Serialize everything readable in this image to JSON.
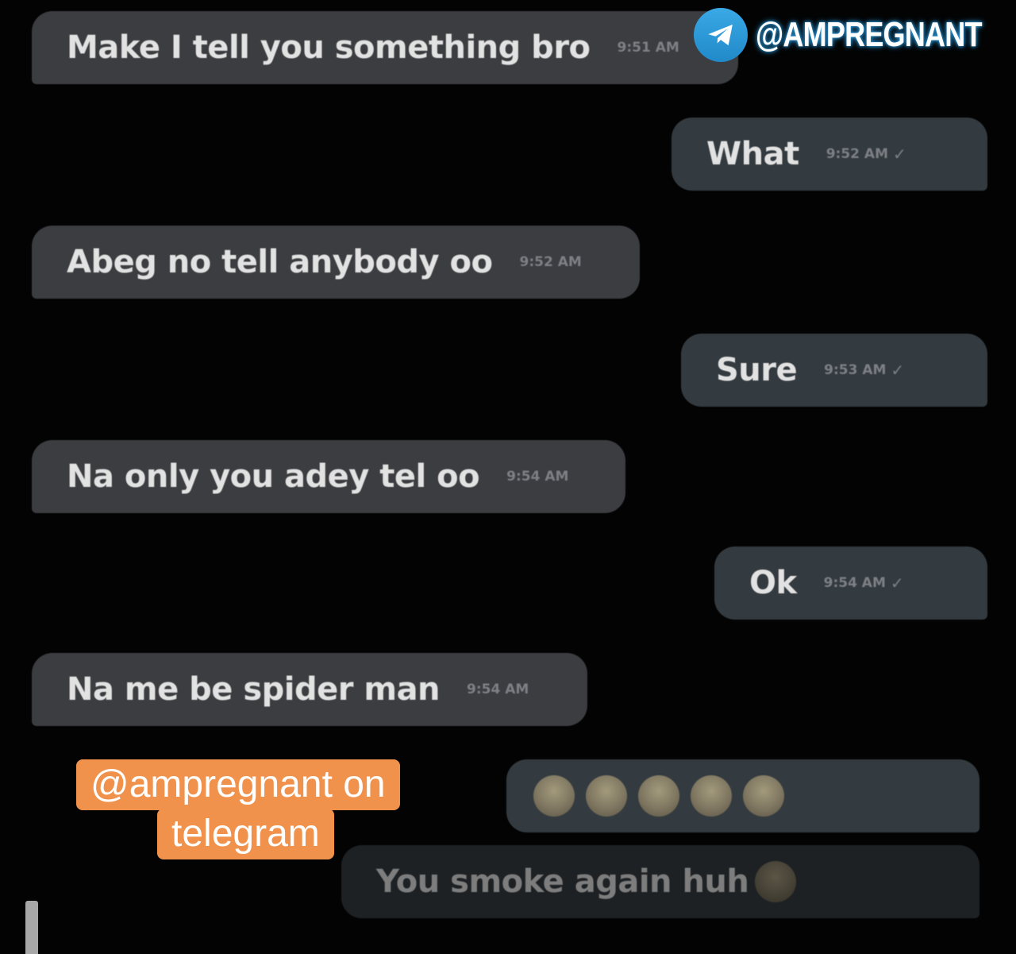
{
  "watermark": {
    "icon": "telegram-logo-icon",
    "handle": "@AMPREGNANT"
  },
  "promo": {
    "line1": "@ampregnant on",
    "line2": "telegram"
  },
  "messages": [
    {
      "direction": "incoming",
      "text": "Make I tell you something bro",
      "time": "9:51 AM"
    },
    {
      "direction": "outgoing",
      "text": "What",
      "time": "9:52 AM"
    },
    {
      "direction": "incoming",
      "text": "Abeg no tell anybody oo",
      "time": "9:52 AM"
    },
    {
      "direction": "outgoing",
      "text": "Sure",
      "time": "9:53 AM"
    },
    {
      "direction": "incoming",
      "text": "Na only you adey tel oo",
      "time": "9:54 AM"
    },
    {
      "direction": "outgoing",
      "text": "Ok",
      "time": "9:54 AM"
    },
    {
      "direction": "incoming",
      "text": "Na me be spider man",
      "time": "9:54 AM"
    },
    {
      "direction": "outgoing",
      "emoji": "skull-emoji",
      "emoji_count": 5,
      "time": ""
    },
    {
      "direction": "outgoing",
      "text": "You smoke again huh",
      "emoji": "skull-emoji",
      "time": ""
    }
  ]
}
